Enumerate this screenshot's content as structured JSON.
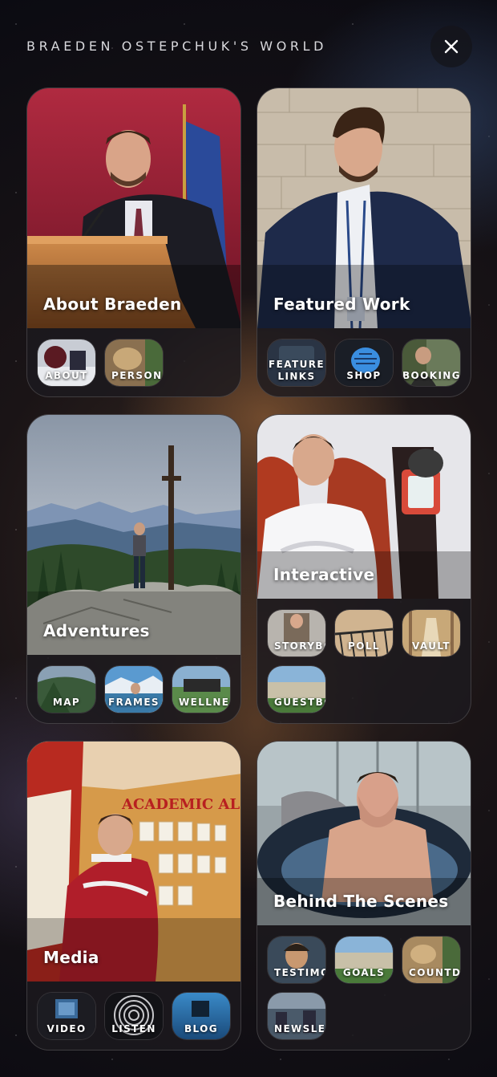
{
  "header": {
    "title": "BRAEDEN OSTEPCHUK'S WORLD"
  },
  "close_icon": "close-icon",
  "cards": [
    {
      "title": "About Braeden",
      "items": [
        "ABOUT",
        "PERSONA"
      ]
    },
    {
      "title": "Featured Work",
      "items": [
        "FEATURE\nLINKS",
        "SHOP",
        "BOOKING"
      ]
    },
    {
      "title": "Adventures",
      "items": [
        "MAP",
        "FRAMES",
        "WELLNES"
      ]
    },
    {
      "title": "Interactive",
      "items": [
        "STORYBO",
        "POLL",
        "VAULT",
        "GUESTBO"
      ]
    },
    {
      "title": "Media",
      "items": [
        "VIDEO",
        "LISTEN",
        "BLOG"
      ]
    },
    {
      "title": "Behind The Scenes",
      "items": [
        "TESTIMO",
        "GOALS",
        "COUNTDO",
        "NEWSLE"
      ]
    }
  ]
}
